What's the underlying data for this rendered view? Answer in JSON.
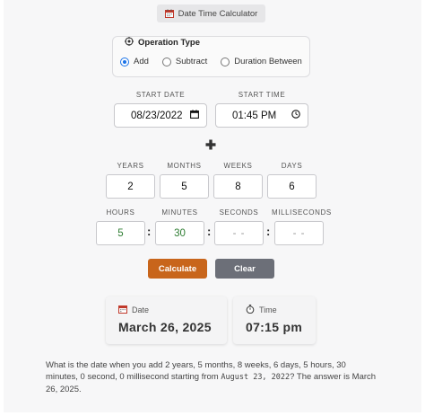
{
  "header": {
    "title": "Date Time Calculator",
    "icon": "calendar-icon"
  },
  "operation": {
    "legend": "Operation Type",
    "options": [
      {
        "label": "Add",
        "checked": true
      },
      {
        "label": "Subtract",
        "checked": false
      },
      {
        "label": "Duration Between",
        "checked": false
      }
    ]
  },
  "start": {
    "date_label": "START DATE",
    "date_value": "08/23/2022",
    "time_label": "START TIME",
    "time_value": "01:45 PM"
  },
  "operator_symbol": "plus-icon",
  "duration": {
    "years_label": "YEARS",
    "years": "2",
    "months_label": "MONTHS",
    "months": "5",
    "weeks_label": "WEEKS",
    "weeks": "8",
    "days_label": "DAYS",
    "days": "6",
    "hours_label": "HOURS",
    "hours": "5",
    "minutes_label": "MINUTES",
    "minutes": "30",
    "seconds_label": "SECONDS",
    "seconds_placeholder": "- -",
    "ms_label": "MILLISECONDS",
    "ms_placeholder": "- -"
  },
  "buttons": {
    "calculate": "Calculate",
    "clear": "Clear"
  },
  "result": {
    "date_label": "Date",
    "date_value": "March 26, 2025",
    "time_label": "Time",
    "time_value": "07:15 pm",
    "text_pre": "What is the date when you add 2 years, 5 months, 8 weeks, 6 days, 5 hours, 30 minutes, 0 second, 0 millisecond starting from ",
    "text_date": "August 23, 2022",
    "text_post": "? The answer is March 26, 2025."
  },
  "colors": {
    "calculate": "#c8651b",
    "clear": "#6c6f78",
    "radio_selected": "#1a73e8",
    "time_values": "#2e7d32"
  }
}
